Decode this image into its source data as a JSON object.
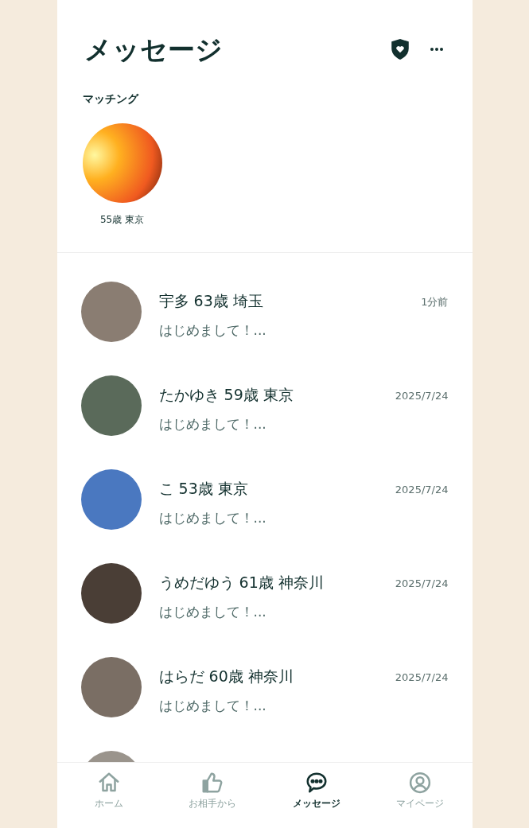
{
  "header": {
    "title": "メッセージ"
  },
  "matching": {
    "label": "マッチング",
    "items": [
      {
        "caption": "55歳 東京"
      }
    ]
  },
  "messages": [
    {
      "name": "宇多 63歳 埼玉",
      "preview": "はじめまして！...",
      "time": "1分前"
    },
    {
      "name": "たかゆき 59歳 東京",
      "preview": "はじめまして！...",
      "time": "2025/7/24"
    },
    {
      "name": "こ 53歳 東京",
      "preview": "はじめまして！...",
      "time": "2025/7/24"
    },
    {
      "name": "うめだゆう 61歳 神奈川",
      "preview": "はじめまして！...",
      "time": "2025/7/24"
    },
    {
      "name": "はらだ 60歳 神奈川",
      "preview": "はじめまして！...",
      "time": "2025/7/24"
    }
  ],
  "nav": [
    {
      "kind": "home",
      "label": "ホーム",
      "selected": false
    },
    {
      "kind": "like",
      "label": "お相手から",
      "selected": false
    },
    {
      "kind": "chat",
      "label": "メッセージ",
      "selected": true
    },
    {
      "kind": "user",
      "label": "マイページ",
      "selected": false
    }
  ]
}
